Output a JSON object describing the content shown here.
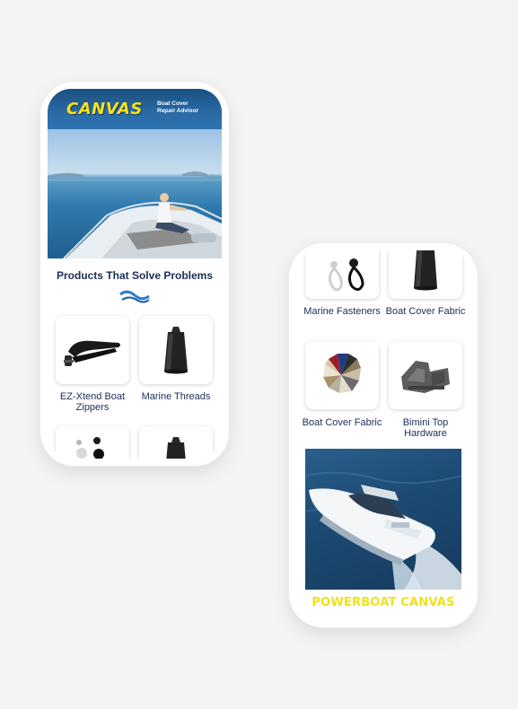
{
  "colors": {
    "brand_navy": "#1c2d55",
    "brand_yellow": "#f5e21a",
    "header_blue": "#2a6aa6",
    "background": "#f4f4f4"
  },
  "phone1": {
    "header": {
      "logo_word": "CANVAS",
      "logo_sub_line1": "Boat Cover",
      "logo_sub_line2": "Repair Advisor"
    },
    "hero_image": "woman-on-yacht-bow",
    "section_title": "Products That Solve Problems",
    "divider_icon": "wave-icon",
    "products": [
      {
        "label": "EZ-Xtend Boat Zippers",
        "icon": "zipper-icon"
      },
      {
        "label": "Marine Threads",
        "icon": "thread-spool-icon"
      },
      {
        "label": "",
        "icon": "fastener-icon"
      },
      {
        "label": "",
        "icon": "thread-spool-icon"
      }
    ]
  },
  "phone2": {
    "products": [
      {
        "label": "Marine Fasteners",
        "icon": "fastener-icon"
      },
      {
        "label": "Boat Cover Fabric",
        "icon": "thread-spool-icon"
      },
      {
        "label": "Boat Cover Fabric",
        "icon": "fabric-swatch-icon"
      },
      {
        "label": "Bimini Top Hardware",
        "icon": "bimini-hardware-icon"
      }
    ],
    "photo": "powerboat-on-water",
    "banner": "POWERBOAT CANVAS"
  }
}
